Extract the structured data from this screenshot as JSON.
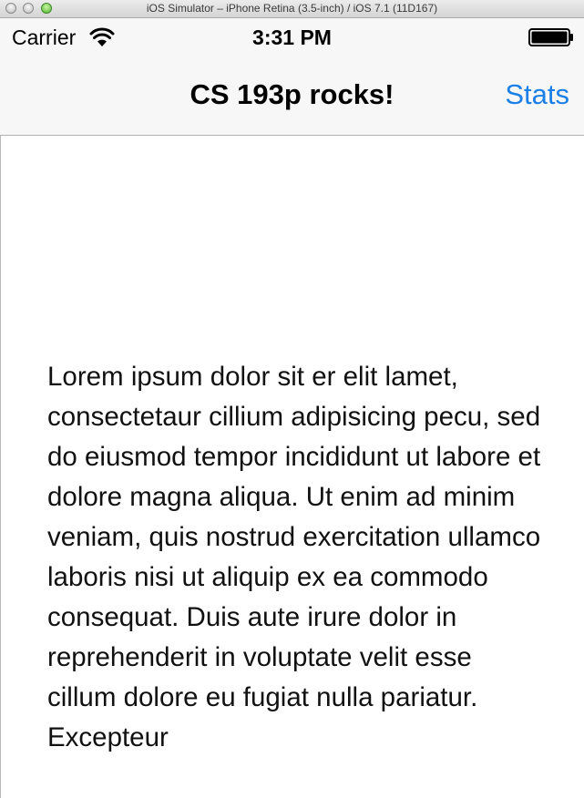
{
  "window": {
    "title": "iOS Simulator – iPhone Retina (3.5-inch) / iOS 7.1 (11D167)"
  },
  "status_bar": {
    "carrier": "Carrier",
    "time": "3:31 PM",
    "wifi_icon": "wifi-icon",
    "battery_icon": "battery-icon",
    "battery_level": 1.0
  },
  "nav_bar": {
    "title": "CS 193p rocks!",
    "right_button": "Stats",
    "accent_color": "#1a7fe6"
  },
  "content": {
    "text": "Lorem ipsum dolor sit er elit lamet, consectetaur cillium adipisicing pecu, sed do eiusmod tempor incididunt ut labore et dolore magna aliqua. Ut enim ad minim veniam, quis nostrud exercitation ullamco laboris nisi ut aliquip ex ea commodo consequat. Duis aute irure dolor in reprehenderit in voluptate velit esse cillum dolore eu fugiat nulla pariatur. Excepteur"
  }
}
